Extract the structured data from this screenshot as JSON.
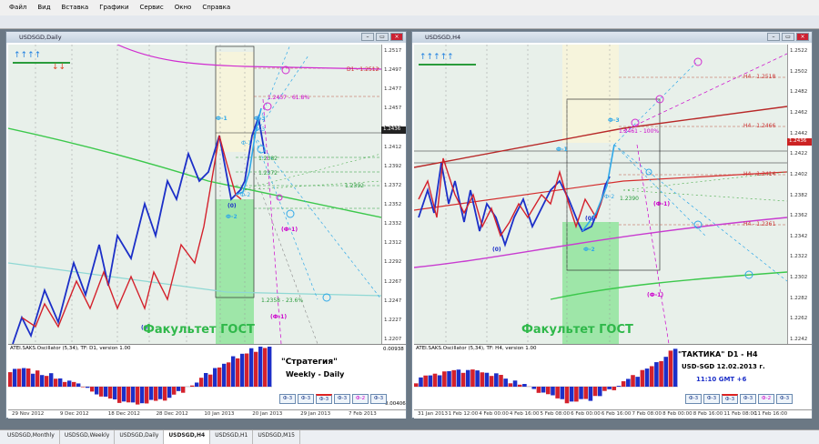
{
  "menu": [
    "Файл",
    "Вид",
    "Вставка",
    "Графики",
    "Сервис",
    "Окно",
    "Справка"
  ],
  "left": {
    "title": "USDSGD,Daily",
    "price_labels": [
      "1.2517",
      "1.2497",
      "1.2477",
      "1.2457",
      "1.2436",
      "1.2412",
      "1.2392",
      "1.2372",
      "1.2352",
      "1.2332",
      "1.2312",
      "1.2292",
      "1.2267",
      "1.2247",
      "1.2227",
      "1.2207"
    ],
    "current_price": "1.2436",
    "osc_header": "ATEI.SAKS.Oscillator (5,34), TF: D1, version 1.00",
    "osc_max": "0.00938",
    "osc_min": "-0.00406",
    "dates": [
      "29 Nov 2012",
      "9 Dec 2012",
      "18 Dec 2012",
      "28 Dec 2012",
      "10 Jan 2013",
      "20 Jan 2013",
      "29 Jan 2013",
      "7 Feb 2013"
    ],
    "watermark": "Факультет ГОСТ",
    "strategy_title": "\"Стратегия\"",
    "strategy_sub": "Weekly - Daily",
    "labels": {
      "phi1": "Ф-1",
      "phi2": "Ф-2",
      "phi3": "Ф-3",
      "zero": "(0)",
      "phim1": "(Ф-1)",
      "phi3b": "Ф-3",
      "phi2b": "Ф-2"
    },
    "lines": [
      "D1 - 1.2512",
      "1.2457 - 61.8%",
      "1.2382",
      "1.2372",
      "1.2392",
      "1.2358 - 23.6%"
    ],
    "nav": [
      "Ф-3",
      "Ф-3",
      "Ф-3",
      "Ф-3",
      "Ф-2",
      "Ф-3"
    ]
  },
  "right": {
    "title": "USDSGD,H4",
    "price_labels": [
      "1.2522",
      "1.2502",
      "1.2482",
      "1.2462",
      "1.2442",
      "1.2422",
      "1.2402",
      "1.2382",
      "1.2362",
      "1.2342",
      "1.2322",
      "1.2302",
      "1.2282",
      "1.2262",
      "1.2242"
    ],
    "current_price": "1.2436",
    "osc_header": "ATEI.SAKS.Oscillator (5,34), TF: H4, version 1.00",
    "dates": [
      "31 Jan 2013",
      "1 Feb 12:00",
      "4 Feb 00:00",
      "4 Feb 16:00",
      "5 Feb 08:00",
      "6 Feb 00:00",
      "6 Feb 16:00",
      "7 Feb 08:00",
      "8 Feb 00:00",
      "8 Feb 16:00",
      "11 Feb 08:00",
      "11 Feb 16:00"
    ],
    "watermark": "Факультет ГОСТ",
    "tactic_title": "\"ТАКТИКА\"    D1 - H4",
    "tactic_pair": "USD-SGD      12.02.2013 г.",
    "tactic_time": "11:10  GMT +6",
    "labels": {
      "phi1": "Ф-1",
      "phi2": "Ф-2",
      "phi3": "Ф-3",
      "zero": "(0)",
      "zero2": "(0)",
      "phim1": "(Ф-1)",
      "phim1b": "(Ф-1)"
    },
    "lines": [
      "H4 - 1.2518",
      "H4 - 1.2466",
      "H4 - 1.2414",
      "H4 - 1.2361",
      "1.2461 - 100%",
      "1.2390"
    ],
    "nav": [
      "Ф-3",
      "Ф-3",
      "Ф-3",
      "Ф-3",
      "Ф-2",
      "Ф-3"
    ]
  },
  "tabs": [
    "USDSGD,Monthly",
    "USDSGD,Weekly",
    "USDSGD,Daily",
    "USDSGD,H4",
    "USDSGD,H1",
    "USDSGD,M15"
  ],
  "active_tab": 3,
  "colors": {
    "bg_plot": "#e8f0ea",
    "blue": "#1c2fc8",
    "red": "#d4212c",
    "cyan": "#2fa8e8",
    "green": "#3cc84c",
    "magenta": "#d02cd0"
  }
}
